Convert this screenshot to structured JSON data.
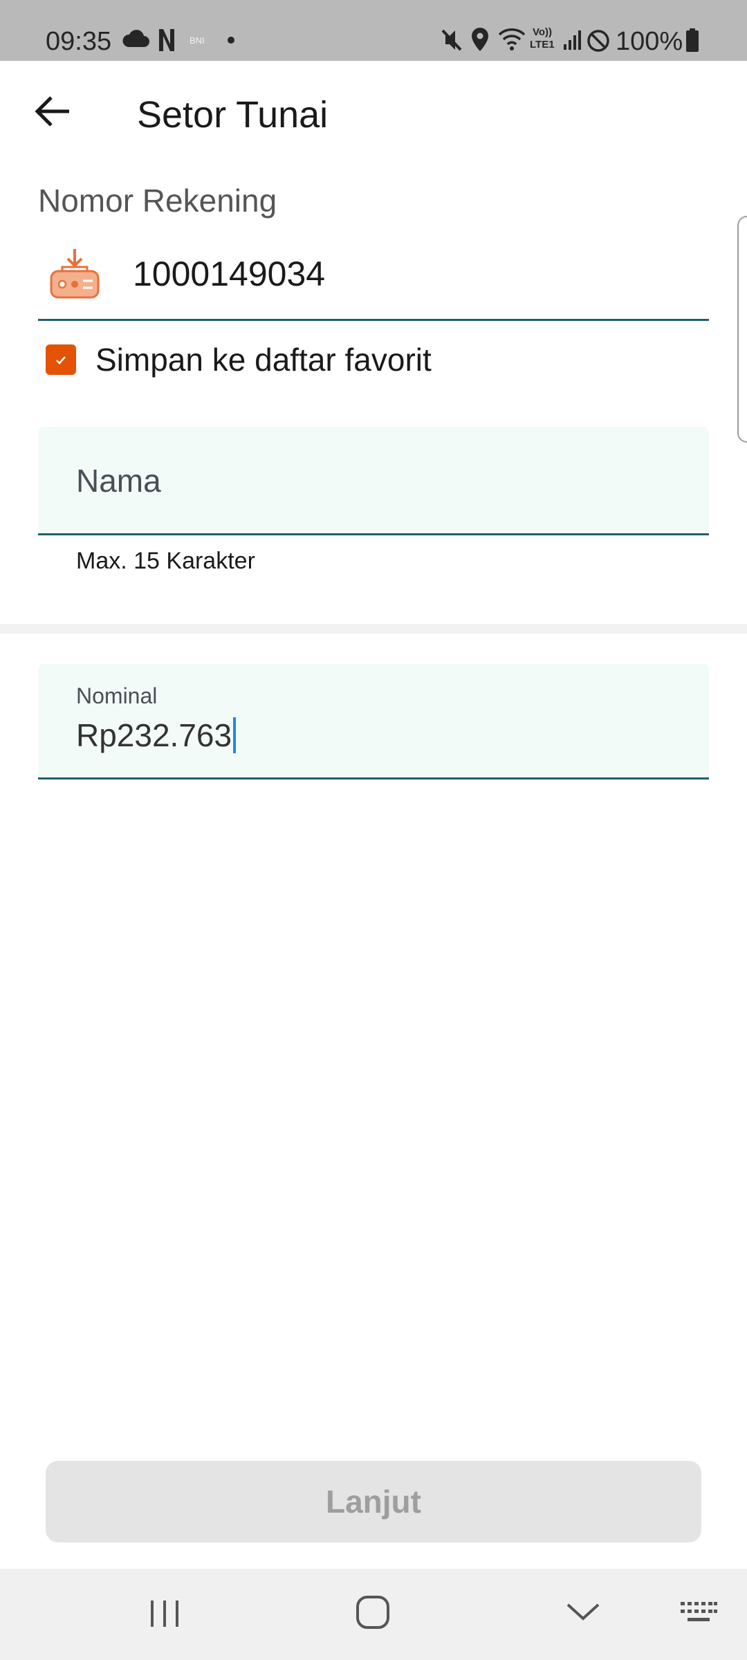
{
  "status_bar": {
    "time": "09:35",
    "notification_icons": [
      "cloud-icon",
      "netflix-icon",
      "bni-icon",
      "dot-icon"
    ],
    "system_icons": [
      "mute-icon",
      "location-icon",
      "wifi-icon",
      "volte-lte-icon",
      "signal-icon",
      "do-not-disturb-icon",
      "battery-icon"
    ],
    "small_labels": {
      "bni": "BNI",
      "volte_top": "Vo))",
      "volte_bottom": "LTE1"
    },
    "battery": "100%"
  },
  "header": {
    "title": "Setor Tunai",
    "back_icon": "arrow-left-icon"
  },
  "account": {
    "label": "Nomor Rekening",
    "number": "1000149034",
    "icon": "cash-deposit-icon",
    "save_favorite": {
      "checked": true,
      "label": "Simpan ke daftar favorit"
    }
  },
  "name_field": {
    "placeholder": "Nama",
    "helper": "Max. 15 Karakter"
  },
  "amount_field": {
    "label": "Nominal",
    "value": "Rp232.763"
  },
  "primary_button": {
    "label": "Lanjut",
    "enabled": false
  },
  "nav_bar": {
    "icons": [
      "recent-apps-icon",
      "home-icon",
      "back-chevron-icon",
      "keyboard-icon"
    ]
  },
  "colors": {
    "accent_orange": "#e35205",
    "field_underline": "#1f5f6b",
    "field_background": "#f3fbf9",
    "caret": "#1e88e5",
    "button_disabled_bg": "#e4e4e4",
    "button_disabled_text": "#9e9e9e"
  }
}
